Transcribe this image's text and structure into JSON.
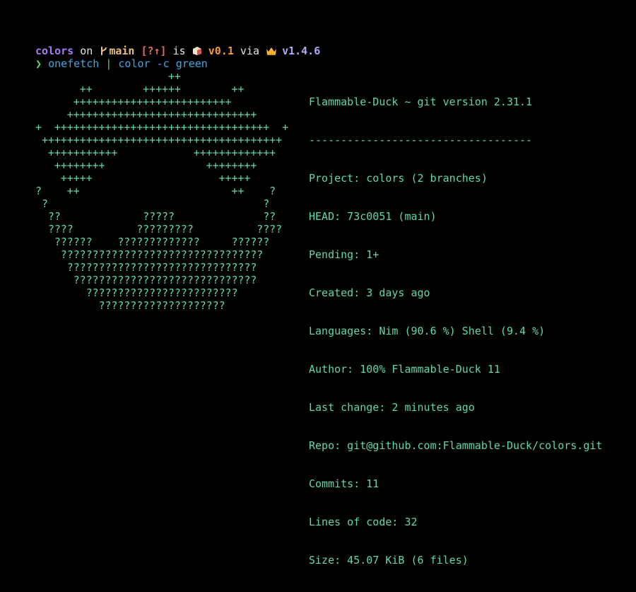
{
  "colors": {
    "background": "#000000",
    "foreground": "#e4e4e4",
    "directory": "#a67bf5",
    "branch": "#e5c07b",
    "git_status": "#e06c5e",
    "version": "#f09a3a",
    "crown_version": "#b4a7f5",
    "prompt_arrow": "#5fd75f",
    "command": "#3fa7e0",
    "art_plus": "#5fd7af",
    "art_question": "#5fd7af",
    "info_text": "#5fd7af"
  },
  "prompt": {
    "directory": "colors",
    "on_word": "on",
    "branch_icon": "git-branch-icon",
    "branch": "main",
    "git_status": "[?↑]",
    "is_word": "is",
    "package_icon": "package-icon",
    "package_version": "v0.1",
    "via_word": "via",
    "crown_icon": "crown-icon",
    "language_version": "v1.4.6"
  },
  "command_line": {
    "arrow": "❯",
    "command": "onefetch",
    "pipe": "|",
    "filter": "color",
    "flag": "-c",
    "argument": "green"
  },
  "ascii_art": [
    "                     ++",
    "       ++        ++++++        ++",
    "      +++++++++++++++++++++++++",
    "     ++++++++++++++++++++++++++++++",
    "+  ++++++++++++++++++++++++++++++++++  +",
    " ++++++++++++++++++++++++++++++++++++++",
    "  +++++++++++            +++++++++++++",
    "   ++++++++                ++++++++",
    "    +++++                    +++++",
    "?    ++                        ++    ?",
    " ?                                  ?",
    "  ??             ?????              ??",
    "  ????          ?????????          ????",
    "   ??????    ?????????????     ??????",
    "    ????????????????????????????????",
    "     ??????????????????????????????",
    "      ?????????????????????????????",
    "        ????????????????????????",
    "          ????????????????????"
  ],
  "info": {
    "title": "Flammable-Duck ~ git version 2.31.1",
    "separator": "-----------------------------------",
    "lines": [
      "Project: colors (2 branches)",
      "HEAD: 73c0051 (main)",
      "Pending: 1+",
      "Created: 3 days ago",
      "Languages: Nim (90.6 %) Shell (9.4 %)",
      "Author: 100% Flammable-Duck 11",
      "Last change: 2 minutes ago",
      "Repo: git@github.com:Flammable-Duck/colors.git",
      "Commits: 11",
      "Lines of code: 32",
      "Size: 45.07 KiB (6 files)"
    ]
  }
}
